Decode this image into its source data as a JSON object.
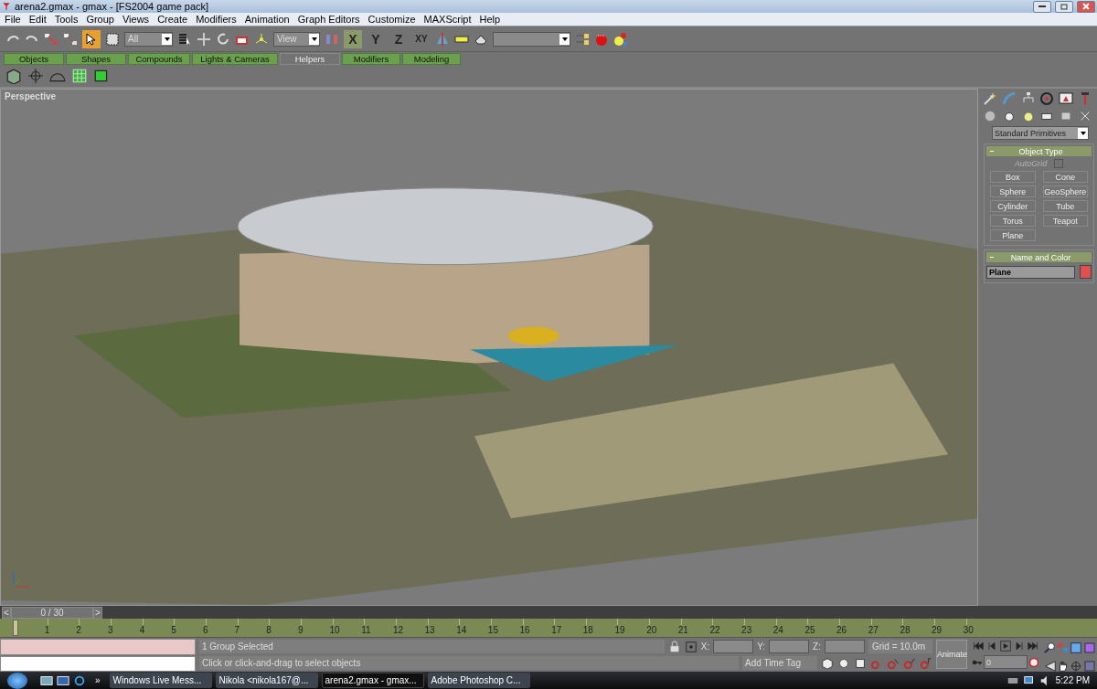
{
  "window": {
    "title": "arena2.gmax - gmax - [FS2004 game pack]"
  },
  "menu": [
    "File",
    "Edit",
    "Tools",
    "Group",
    "Views",
    "Create",
    "Modifiers",
    "Animation",
    "Graph Editors",
    "Customize",
    "MAXScript",
    "Help"
  ],
  "toolbar": {
    "selection_filter": "All",
    "reference_coord": "View",
    "axes": [
      {
        "label": "X",
        "selected": true
      },
      {
        "label": "Y",
        "selected": false
      },
      {
        "label": "Z",
        "selected": false
      },
      {
        "label": "XY",
        "selected": false
      }
    ]
  },
  "tabs": [
    {
      "label": "Objects",
      "selected": false
    },
    {
      "label": "Shapes",
      "selected": false
    },
    {
      "label": "Compounds",
      "selected": false
    },
    {
      "label": "Lights & Cameras",
      "selected": false
    },
    {
      "label": "Helpers",
      "selected": true
    },
    {
      "label": "Modifiers",
      "selected": false
    },
    {
      "label": "Modeling",
      "selected": false
    }
  ],
  "viewport": {
    "label": "Perspective"
  },
  "command_panel": {
    "category": "Standard Primitives",
    "object_type": {
      "title": "Object Type",
      "autogrid": {
        "label": "AutoGrid",
        "checked": false,
        "disabled": true
      },
      "buttons": [
        "Box",
        "Cone",
        "Sphere",
        "GeoSphere",
        "Cylinder",
        "Tube",
        "Torus",
        "Teapot",
        "Plane"
      ]
    },
    "name_and_color": {
      "title": "Name and Color",
      "name": "Plane",
      "color": "#e05050"
    }
  },
  "time_slider": {
    "label": "0 / 30",
    "prev": "<",
    "next": ">"
  },
  "track_bar": {
    "ticks": [
      "1",
      "2",
      "3",
      "4",
      "5",
      "6",
      "7",
      "8",
      "9",
      "10",
      "11",
      "12",
      "13",
      "14",
      "15",
      "16",
      "17",
      "18",
      "19",
      "20",
      "21",
      "22",
      "23",
      "24",
      "25",
      "26",
      "27",
      "28",
      "29",
      "30"
    ]
  },
  "status": {
    "selection": "1 Group Selected",
    "prompt": "Click or click-and-drag to select objects",
    "x_label": "X:",
    "y_label": "Y:",
    "z_label": "Z:",
    "grid": "Grid = 10.0m",
    "time_tag": "Add Time Tag",
    "animate": "Animate",
    "frame": "0"
  },
  "taskbar": {
    "overflow": "»",
    "tasks": [
      {
        "label": "Windows Live Mess...",
        "selected": false
      },
      {
        "label": "Nikola <nikola167@...",
        "selected": false
      },
      {
        "label": "arena2.gmax - gmax...",
        "selected": true
      },
      {
        "label": "Adobe Photoshop C...",
        "selected": false
      }
    ],
    "time": "5:22 PM"
  }
}
